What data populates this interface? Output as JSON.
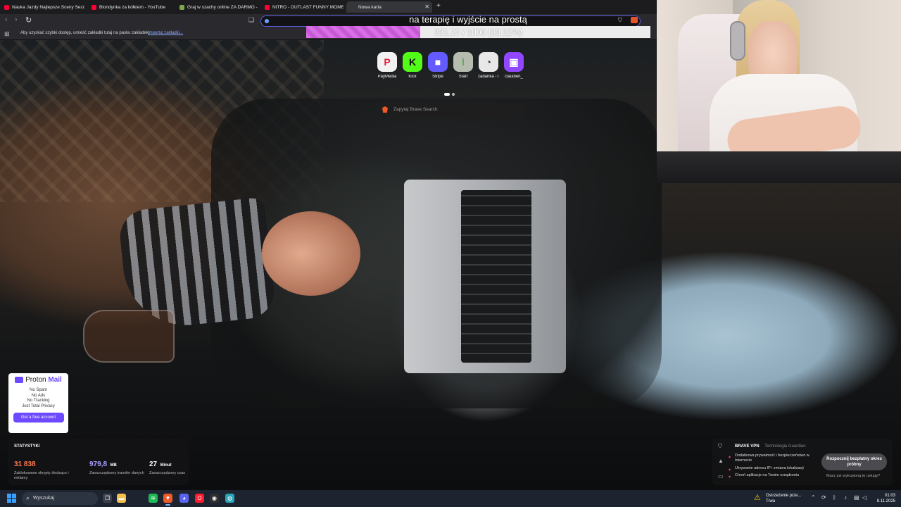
{
  "browser": {
    "tabs": [
      {
        "label": "Nauka Jazdy Najlepsze Sceny Sezon 6 | Top",
        "favicon_color": "#ff0033"
      },
      {
        "label": "Blondynka za kółkiem - YouTube",
        "favicon_color": "#ff0033"
      },
      {
        "label": "Graj w szachy online ZA DARMO - szachy",
        "favicon_color": "#7fa650"
      },
      {
        "label": "NITRO - OUTLAST FUNNY MOMENTS!",
        "favicon_color": "#ff0033"
      },
      {
        "label": "Nowa karta",
        "favicon_color": "#35363a"
      }
    ],
    "new_tab_symbol": "+",
    "close_symbol": "✕",
    "bookmarks_bar": {
      "text": "Aby uzyskać szybki dostęp, umieść zakładki tutaj na pasku zakładek.",
      "link": "Importuj zakładki..."
    },
    "speed_dial": [
      {
        "label": "PayMedia",
        "glyph": "P",
        "bg": "#f2f2f2",
        "fg": "#e0233c"
      },
      {
        "label": "Kick",
        "glyph": "K",
        "bg": "#53fc18",
        "fg": "#0b0b0b"
      },
      {
        "label": "Stripe",
        "glyph": "■",
        "bg": "#635bff",
        "fg": "#ffffff"
      },
      {
        "label": "Start",
        "glyph": "ǀ",
        "bg": "#b6bcb0",
        "fg": "#52a84a"
      },
      {
        "label": "zadanka - l...",
        "glyph": "◔",
        "bg": "#e8e8e8",
        "fg": "#333333"
      },
      {
        "label": "claudien_",
        "glyph": "▣",
        "bg": "#9146ff",
        "fg": "#ffffff"
      }
    ],
    "search_placeholder": "Zapytaj Brave Search"
  },
  "goal": {
    "title": "na terapię i wyjście na prostą",
    "text": "331,20 / 1000 (33,12%)",
    "progress": 0.3312
  },
  "proton": {
    "brand_a": "Proton",
    "brand_b": "Mail",
    "lines": [
      "No Spam",
      "No Ads",
      "No Tracking",
      "Just Total Privacy"
    ],
    "cta": "Get a free account"
  },
  "stats": {
    "title": "STATYSTYKI",
    "items": [
      {
        "value": "31 838",
        "unit": "",
        "caption": "Zablokowane skrypty śledzące i reklamy",
        "color": "#ff7a4d"
      },
      {
        "value": "979,8",
        "unit": "MB",
        "caption": "Zaoszczędzony transfer danych",
        "color": "#a8a2ff"
      },
      {
        "value": "27",
        "unit": "Minut",
        "caption": "Zaoszczędzony czas",
        "color": "#ffffff"
      }
    ]
  },
  "vpn": {
    "brand": "BRAVE VPN",
    "tech": "Technologia Guardian",
    "features": [
      "Dodatkowa prywatność i bezpieczeństwo w Internecie",
      "Ukrywanie adresu IP i zmiana lokalizacji",
      "Chroń aplikacje na Twoim urządzeniu"
    ],
    "cta": "Rozpocznij bezpłatny okres próbny",
    "link": "Masz już wykupioną tę usługę?"
  },
  "taskbar": {
    "search_label": "Wyszukaj",
    "weather_title": "Ostrzeżenie prze...",
    "weather_sub": "Trwa",
    "time": "01:03",
    "date": "8.11.2025",
    "apps": [
      {
        "name": "task-view",
        "glyph": "❐",
        "color": "#3a3f4a"
      },
      {
        "name": "file-explorer",
        "glyph": "▬",
        "color": "#f2c14e"
      },
      {
        "name": "spotify",
        "glyph": "≋",
        "color": "#1db954"
      },
      {
        "name": "brave",
        "glyph": "▼",
        "color": "#f05a28"
      },
      {
        "name": "discord",
        "glyph": "◕",
        "color": "#5865f2"
      },
      {
        "name": "opera",
        "glyph": "O",
        "color": "#ff1b2d"
      },
      {
        "name": "obs",
        "glyph": "◉",
        "color": "#302e31"
      },
      {
        "name": "globe",
        "glyph": "◍",
        "color": "#2aa4b8"
      }
    ]
  }
}
